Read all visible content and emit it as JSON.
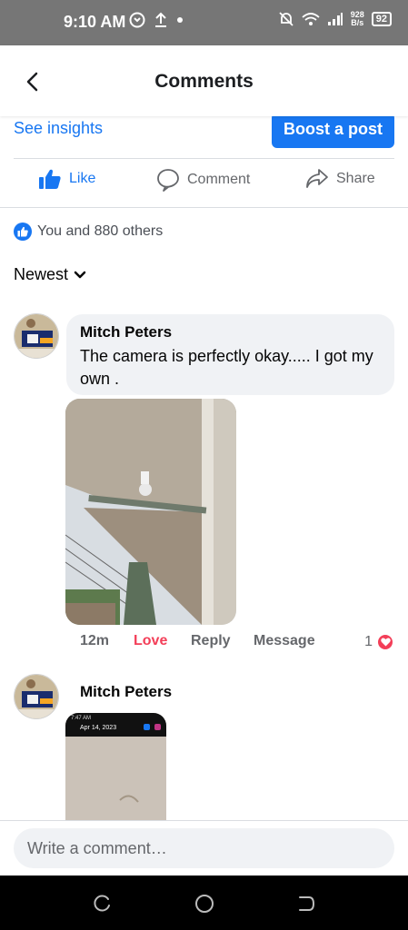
{
  "status_bar": {
    "time": "9:10 AM",
    "net_speed_value": "928",
    "net_speed_unit": "B/s",
    "battery": "92",
    "icons": [
      "whatsapp-icon",
      "upload-icon",
      "dot-icon",
      "mute-icon",
      "wifi-icon",
      "signal-icon",
      "battery-icon"
    ]
  },
  "header": {
    "title": "Comments"
  },
  "insights": {
    "see_insights": "See insights",
    "boost": "Boost a post"
  },
  "actions": {
    "like": "Like",
    "comment": "Comment",
    "share": "Share"
  },
  "reactions": {
    "summary": "You and 880 others"
  },
  "sort": {
    "label": "Newest"
  },
  "comments": [
    {
      "author": "Mitch Peters",
      "text": "The camera is perfectly okay..... I got my own .",
      "time": "12m",
      "reaction_label": "Love",
      "reply": "Reply",
      "message": "Message",
      "reaction_count": "1"
    },
    {
      "author": "Mitch Peters",
      "thumb_status": "7:47 AM",
      "thumb_date": "Apr 14, 2023"
    }
  ],
  "composer": {
    "placeholder": "Write a comment…"
  },
  "colors": {
    "accent": "#1877f2",
    "love": "#f33e58",
    "bubble": "#f0f2f5"
  }
}
